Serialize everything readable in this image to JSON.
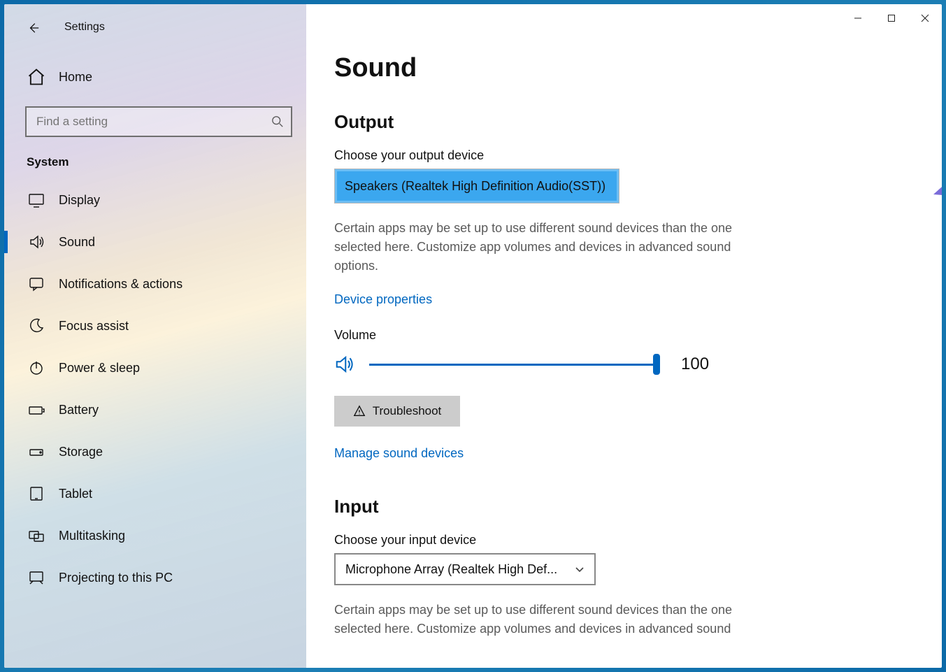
{
  "app_title": "Settings",
  "home_label": "Home",
  "search_placeholder": "Find a setting",
  "section_header": "System",
  "nav": [
    {
      "id": "display",
      "label": "Display"
    },
    {
      "id": "sound",
      "label": "Sound"
    },
    {
      "id": "notifications",
      "label": "Notifications & actions"
    },
    {
      "id": "focus",
      "label": "Focus assist"
    },
    {
      "id": "power",
      "label": "Power & sleep"
    },
    {
      "id": "battery",
      "label": "Battery"
    },
    {
      "id": "storage",
      "label": "Storage"
    },
    {
      "id": "tablet",
      "label": "Tablet"
    },
    {
      "id": "multitasking",
      "label": "Multitasking"
    },
    {
      "id": "projecting",
      "label": "Projecting to this PC"
    }
  ],
  "page": {
    "title": "Sound",
    "output": {
      "heading": "Output",
      "choose_label": "Choose your output device",
      "selected": "Speakers (Realtek High Definition Audio(SST))",
      "help": "Certain apps may be set up to use different sound devices than the one selected here. Customize app volumes and devices in advanced sound options.",
      "device_props_link": "Device properties",
      "volume_label": "Volume",
      "volume_value": "100",
      "troubleshoot_label": "Troubleshoot",
      "manage_link": "Manage sound devices"
    },
    "input": {
      "heading": "Input",
      "choose_label": "Choose your input device",
      "selected": "Microphone Array (Realtek High Def...",
      "help": "Certain apps may be set up to use different sound devices than the one selected here. Customize app volumes and devices in advanced sound"
    }
  }
}
